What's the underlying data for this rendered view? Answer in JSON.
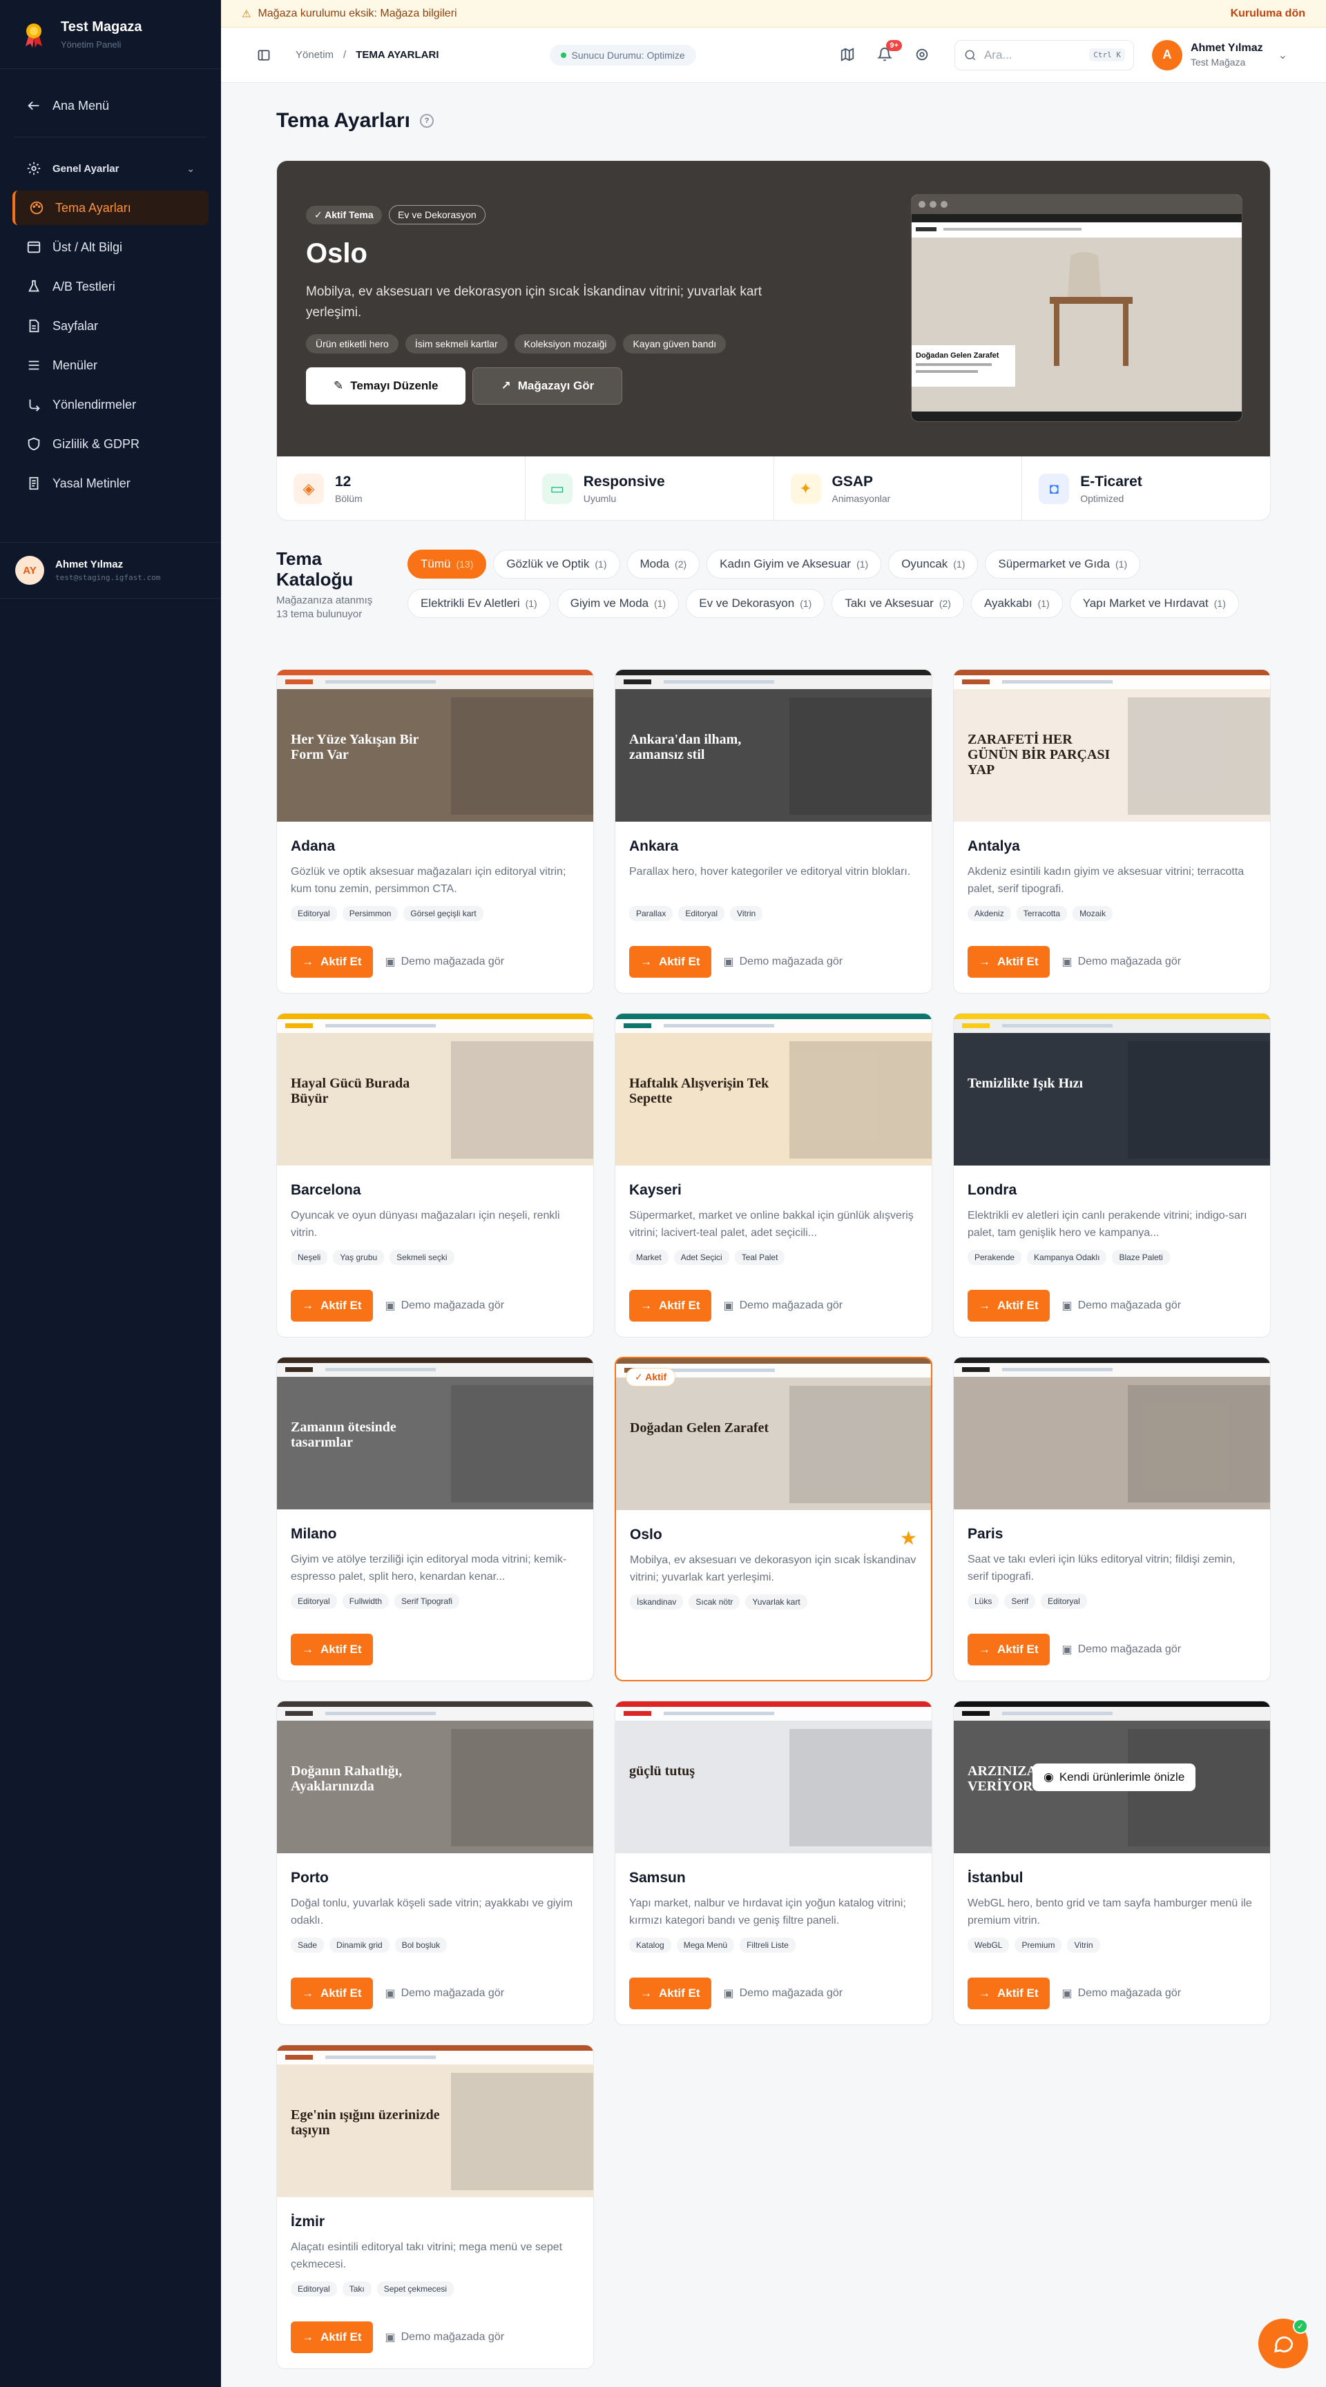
{
  "sidebar": {
    "brand_title": "Test Magaza",
    "brand_sub": "Yönetim Paneli",
    "back_label": "Ana Menü",
    "group_label": "Genel Ayarlar",
    "items": [
      {
        "label": "Tema Ayarları",
        "icon": "palette-icon"
      },
      {
        "label": "Üst / Alt Bilgi",
        "icon": "layout-icon"
      },
      {
        "label": "A/B Testleri",
        "icon": "flask-icon"
      },
      {
        "label": "Sayfalar",
        "icon": "file-icon"
      },
      {
        "label": "Menüler",
        "icon": "menu-icon"
      },
      {
        "label": "Yönlendirmeler",
        "icon": "redirect-icon"
      },
      {
        "label": "Gizlilik & GDPR",
        "icon": "shield-icon"
      },
      {
        "label": "Yasal Metinler",
        "icon": "document-icon"
      }
    ],
    "user": {
      "initials": "AY",
      "name": "Ahmet Yılmaz",
      "email": "test@staging.igfast.com"
    }
  },
  "banner": {
    "text": "Mağaza kurulumu eksik: Mağaza bilgileri",
    "cta": "Kuruluma dön"
  },
  "header": {
    "crumb_root": "Yönetim",
    "crumb_current": "TEMA AYARLARI",
    "status": "Sunucu Durumu: Optimize",
    "notif_badge": "9+",
    "search_placeholder": "Ara...",
    "search_kbd": "Ctrl K",
    "user_initial": "A",
    "user_name": "Ahmet Yılmaz",
    "user_store": "Test Mağaza"
  },
  "page": {
    "title": "Tema Ayarları"
  },
  "hero": {
    "active_chip": "✓ Aktif Tema",
    "category_chip": "Ev ve Dekorasyon",
    "name": "Oslo",
    "desc": "Mobilya, ev aksesuarı ve dekorasyon için sıcak İskandinav vitrini; yuvarlak kart yerleşimi.",
    "tags": [
      "Ürün etiketli hero",
      "İsim sekmeli kartlar",
      "Koleksiyon mozaiği",
      "Kayan güven bandı"
    ],
    "edit_label": "Temayı Düzenle",
    "view_label": "Mağazayı Gör",
    "preview_caption": "Doğadan Gelen Zarafet",
    "stats": [
      {
        "value": "12",
        "label": "Bölüm",
        "color": "#fff1e6",
        "icon": "layers-icon"
      },
      {
        "value": "Responsive",
        "label": "Uyumlu",
        "color": "#e7f8ef",
        "icon": "monitor-icon"
      },
      {
        "value": "GSAP",
        "label": "Animasyonlar",
        "color": "#fff7e0",
        "icon": "sparkle-icon"
      },
      {
        "value": "E-Ticaret",
        "label": "Optimized",
        "color": "#eaf0fe",
        "icon": "bag-icon"
      }
    ]
  },
  "catalog": {
    "title": "Tema Kataloğu",
    "subtitle": "Mağazanıza atanmış 13 tema bulunuyor",
    "filters": [
      {
        "label": "Tümü",
        "count": "(13)"
      },
      {
        "label": "Gözlük ve Optik",
        "count": "(1)"
      },
      {
        "label": "Moda",
        "count": "(2)"
      },
      {
        "label": "Kadın Giyim ve Aksesuar",
        "count": "(1)"
      },
      {
        "label": "Oyuncak",
        "count": "(1)"
      },
      {
        "label": "Süpermarket ve Gıda",
        "count": "(1)"
      },
      {
        "label": "Elektrikli Ev Aletleri",
        "count": "(1)"
      },
      {
        "label": "Giyim ve Moda",
        "count": "(1)"
      },
      {
        "label": "Ev ve Dekorasyon",
        "count": "(1)"
      },
      {
        "label": "Takı ve Aksesuar",
        "count": "(2)"
      },
      {
        "label": "Ayakkabı",
        "count": "(1)"
      },
      {
        "label": "Yapı Market ve Hırdavat",
        "count": "(1)"
      }
    ],
    "action_label": "Aktif Et",
    "demo_label": "Demo mağazada gör",
    "active_label": "Aktif",
    "preview_own_label": "Kendi ürünlerimle önizle",
    "themes": [
      {
        "name": "Adana",
        "desc": "Gözlük ve optik aksesuar mağazaları için editoryal vitrin; kum tonu zemin, persimmon CTA.",
        "tags": [
          "Editoryal",
          "Persimmon",
          "Görsel geçişli kart"
        ],
        "headline": "Her Yüze Yakışan Bir Form Var",
        "bg": "#7a6a5a",
        "accent": "#d85a2a"
      },
      {
        "name": "Ankara",
        "desc": "Parallax hero, hover kategoriler ve editoryal vitrin blokları.",
        "tags": [
          "Parallax",
          "Editoryal",
          "Vitrin"
        ],
        "headline": "Ankara'dan ilham, zamansız stil",
        "bg": "#4a4a4a",
        "accent": "#222222"
      },
      {
        "name": "Antalya",
        "desc": "Akdeniz esintili kadın giyim ve aksesuar vitrini; terracotta palet, serif tipografi.",
        "tags": [
          "Akdeniz",
          "Terracotta",
          "Mozaik"
        ],
        "headline": "ZARAFETİ HER GÜNÜN BİR PARÇASI YAP",
        "bg": "#f4ece2",
        "accent": "#b5532a"
      },
      {
        "name": "Barcelona",
        "desc": "Oyuncak ve oyun dünyası mağazaları için neşeli, renkli vitrin.",
        "tags": [
          "Neşeli",
          "Yaş grubu",
          "Sekmeli seçki"
        ],
        "headline": "Hayal Gücü Burada Büyür",
        "bg": "#efe3d2",
        "accent": "#f5b400"
      },
      {
        "name": "Kayseri",
        "desc": "Süpermarket, market ve online bakkal için günlük alışveriş vitrini; lacivert-teal palet, adet seçicili...",
        "tags": [
          "Market",
          "Adet Seçici",
          "Teal Palet"
        ],
        "headline": "Haftalık Alışverişin Tek Sepette",
        "bg": "#f3e3c8",
        "accent": "#0f766e"
      },
      {
        "name": "Londra",
        "desc": "Elektrikli ev aletleri için canlı perakende vitrini; indigo-sarı palet, tam genişlik hero ve kampanya...",
        "tags": [
          "Perakende",
          "Kampanya Odaklı",
          "Blaze Paleti"
        ],
        "headline": "Temizlikte Işık Hızı",
        "bg": "#2f3640",
        "accent": "#facc15"
      },
      {
        "name": "Milano",
        "desc": "Giyim ve atölye terziliği için editoryal moda vitrini; kemik-espresso palet, split hero, kenardan kenar...",
        "tags": [
          "Editoryal",
          "Fullwidth",
          "Serif Tipografi"
        ],
        "headline": "Zamanın ötesinde tasarımlar",
        "bg": "#6b6b6b",
        "accent": "#3b2a20"
      },
      {
        "name": "Oslo",
        "desc": "Mobilya, ev aksesuarı ve dekorasyon için sıcak İskandinav vitrini; yuvarlak kart yerleşimi.",
        "tags": [
          "İskandinav",
          "Sıcak nötr",
          "Yuvarlak kart"
        ],
        "headline": "Doğadan Gelen Zarafet",
        "bg": "#d9d2c8",
        "accent": "#8b5e3c"
      },
      {
        "name": "Paris",
        "desc": "Saat ve takı evleri için lüks editoryal vitrin; fildişi zemin, serif tipografi.",
        "tags": [
          "Lüks",
          "Serif",
          "Editoryal"
        ],
        "headline": "",
        "bg": "#b8aea3",
        "accent": "#1f1f1f"
      },
      {
        "name": "Porto",
        "desc": "Doğal tonlu, yuvarlak köşeli sade vitrin; ayakkabı ve giyim odaklı.",
        "tags": [
          "Sade",
          "Dinamik grid",
          "Bol boşluk"
        ],
        "headline": "Doğanın Rahatlığı, Ayaklarınızda",
        "bg": "#8a857e",
        "accent": "#3f3a35"
      },
      {
        "name": "Samsun",
        "desc": "Yapı market, nalbur ve hırdavat için yoğun katalog vitrini; kırmızı kategori bandı ve geniş filtre paneli.",
        "tags": [
          "Katalog",
          "Mega Menü",
          "Filtreli Liste"
        ],
        "headline": "güçlü tutuş",
        "bg": "#e5e7eb",
        "accent": "#dc2626"
      },
      {
        "name": "İstanbul",
        "desc": "WebGL hero, bento grid ve tam sayfa hamburger menü ile premium vitrin.",
        "tags": [
          "WebGL",
          "Premium",
          "Vitrin"
        ],
        "headline": "ARZINIZA ÖZEL VERİYORUZ",
        "bg": "#5a5a5a",
        "accent": "#111111"
      },
      {
        "name": "İzmir",
        "desc": "Alaçatı esintili editoryal takı vitrini; mega menü ve sepet çekmecesi.",
        "tags": [
          "Editoryal",
          "Takı",
          "Sepet çekmecesi"
        ],
        "headline": "Ege'nin ışığını üzerinizde taşıyın",
        "bg": "#f1e6d6",
        "accent": "#b4532a"
      }
    ]
  }
}
